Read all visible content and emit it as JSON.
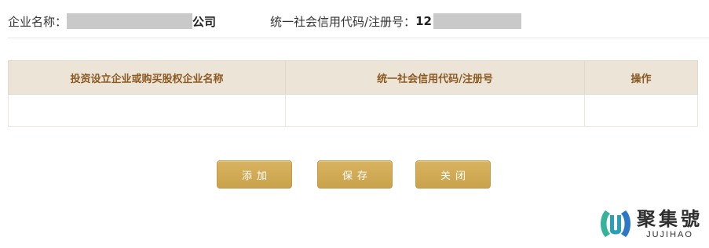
{
  "company_info": {
    "name_label": "企业名称：",
    "name_suffix": "公司",
    "credit_label": "统一社会信用代码/注册号：",
    "credit_prefix": "12"
  },
  "table": {
    "columns": [
      "投资设立企业或购买股权企业名称",
      "统一社会信用代码/注册号",
      "操作"
    ]
  },
  "buttons": {
    "add": "添加",
    "save": "保存",
    "close": "关闭"
  },
  "watermark": {
    "name_cn": "聚集號",
    "name_en": "JUJIHAO"
  },
  "colors": {
    "header_bg": "#ede4d8",
    "header_text": "#8a5a22",
    "button_bg": "#d1ab56",
    "logo_green": "#35b39a",
    "logo_blue": "#2b78c8"
  }
}
